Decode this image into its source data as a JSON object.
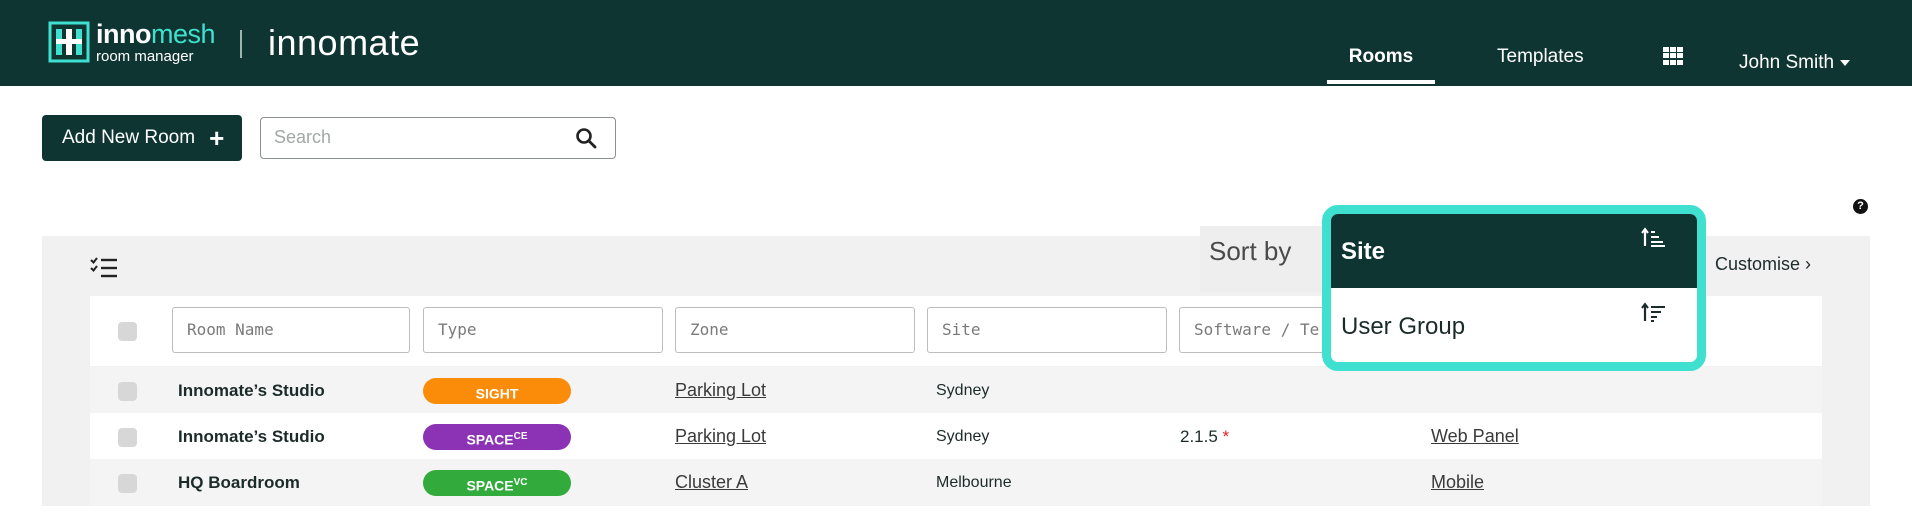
{
  "header": {
    "logo_brand_a": "inno",
    "logo_brand_b": "mesh",
    "logo_sub": "room manager",
    "product": "innomate",
    "nav": {
      "rooms": "Rooms",
      "templates": "Templates"
    },
    "user": "John Smith"
  },
  "toolbar": {
    "add_label": "Add New Room",
    "add_icon": "+",
    "search_placeholder": "Search"
  },
  "help_icon": "?",
  "table": {
    "sort_label": "Sort by",
    "customise_label": "Customise",
    "filters": {
      "room_name": "Room Name",
      "type": "Type",
      "zone": "Zone",
      "site": "Site",
      "software": "Software / Te"
    },
    "rows": [
      {
        "name": "Innomate’s Studio",
        "type": "SIGHT",
        "type_sup": "",
        "type_color": "#fb8c0a",
        "zone": "Parking Lot",
        "site": "Sydney",
        "software": "",
        "software_flag": "",
        "panel": ""
      },
      {
        "name": "Innomate’s Studio",
        "type": "SPACE",
        "type_sup": "CE",
        "type_color": "#8c32b4",
        "zone": "Parking Lot",
        "site": "Sydney",
        "software": "2.1.5",
        "software_flag": "*",
        "panel": "Web Panel"
      },
      {
        "name": "HQ Boardroom",
        "type": "SPACE",
        "type_sup": "VC",
        "type_color": "#32aa3c",
        "zone": "Cluster A",
        "site": "Melbourne",
        "software": "",
        "software_flag": "",
        "panel": "Mobile"
      }
    ]
  },
  "sort_popup": {
    "options": [
      {
        "label": "Site",
        "icon": "sort-ascending-lines-icon",
        "selected": true
      },
      {
        "label": "User Group",
        "icon": "sort-ascending-filter-icon",
        "selected": false
      }
    ],
    "highlight_color": "#3fe0cf"
  },
  "colors": {
    "brand_dark": "#0e3532",
    "accent": "#3fe0cf"
  }
}
